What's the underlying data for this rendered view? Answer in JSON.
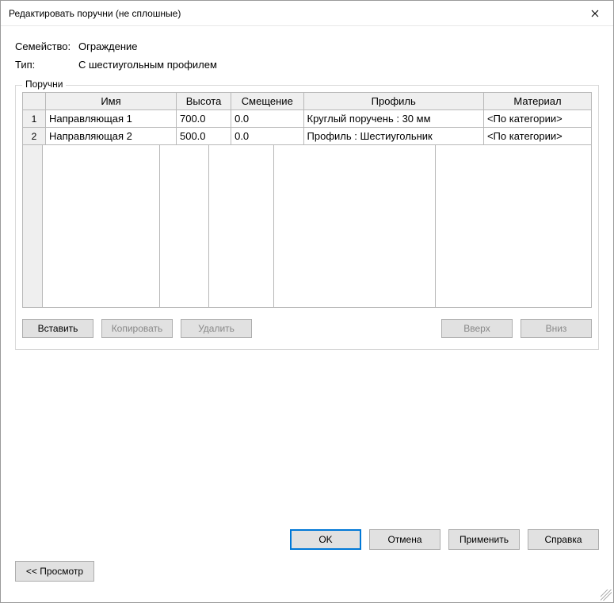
{
  "window": {
    "title": "Редактировать поручни (не сплошные)"
  },
  "meta": {
    "family_label": "Семейство:",
    "family_value": "Ограждение",
    "type_label": "Тип:",
    "type_value": "С шестиугольным профилем"
  },
  "fieldset": {
    "legend": "Поручни"
  },
  "table": {
    "headers": {
      "row": "",
      "name": "Имя",
      "height": "Высота",
      "offset": "Смещение",
      "profile": "Профиль",
      "material": "Материал"
    },
    "rows": [
      {
        "num": "1",
        "name": "Направляющая 1",
        "height": "700.0",
        "offset": "0.0",
        "profile": "Круглый поручень : 30 мм",
        "material": "<По категории>"
      },
      {
        "num": "2",
        "name": "Направляющая 2",
        "height": "500.0",
        "offset": "0.0",
        "profile": "Профиль : Шестиугольник",
        "material": "<По категории>"
      }
    ]
  },
  "buttons": {
    "insert": "Вставить",
    "copy": "Копировать",
    "delete": "Удалить",
    "up": "Вверх",
    "down": "Вниз",
    "ok": "OK",
    "cancel": "Отмена",
    "apply": "Применить",
    "help": "Справка",
    "preview": "<<  Просмотр"
  }
}
